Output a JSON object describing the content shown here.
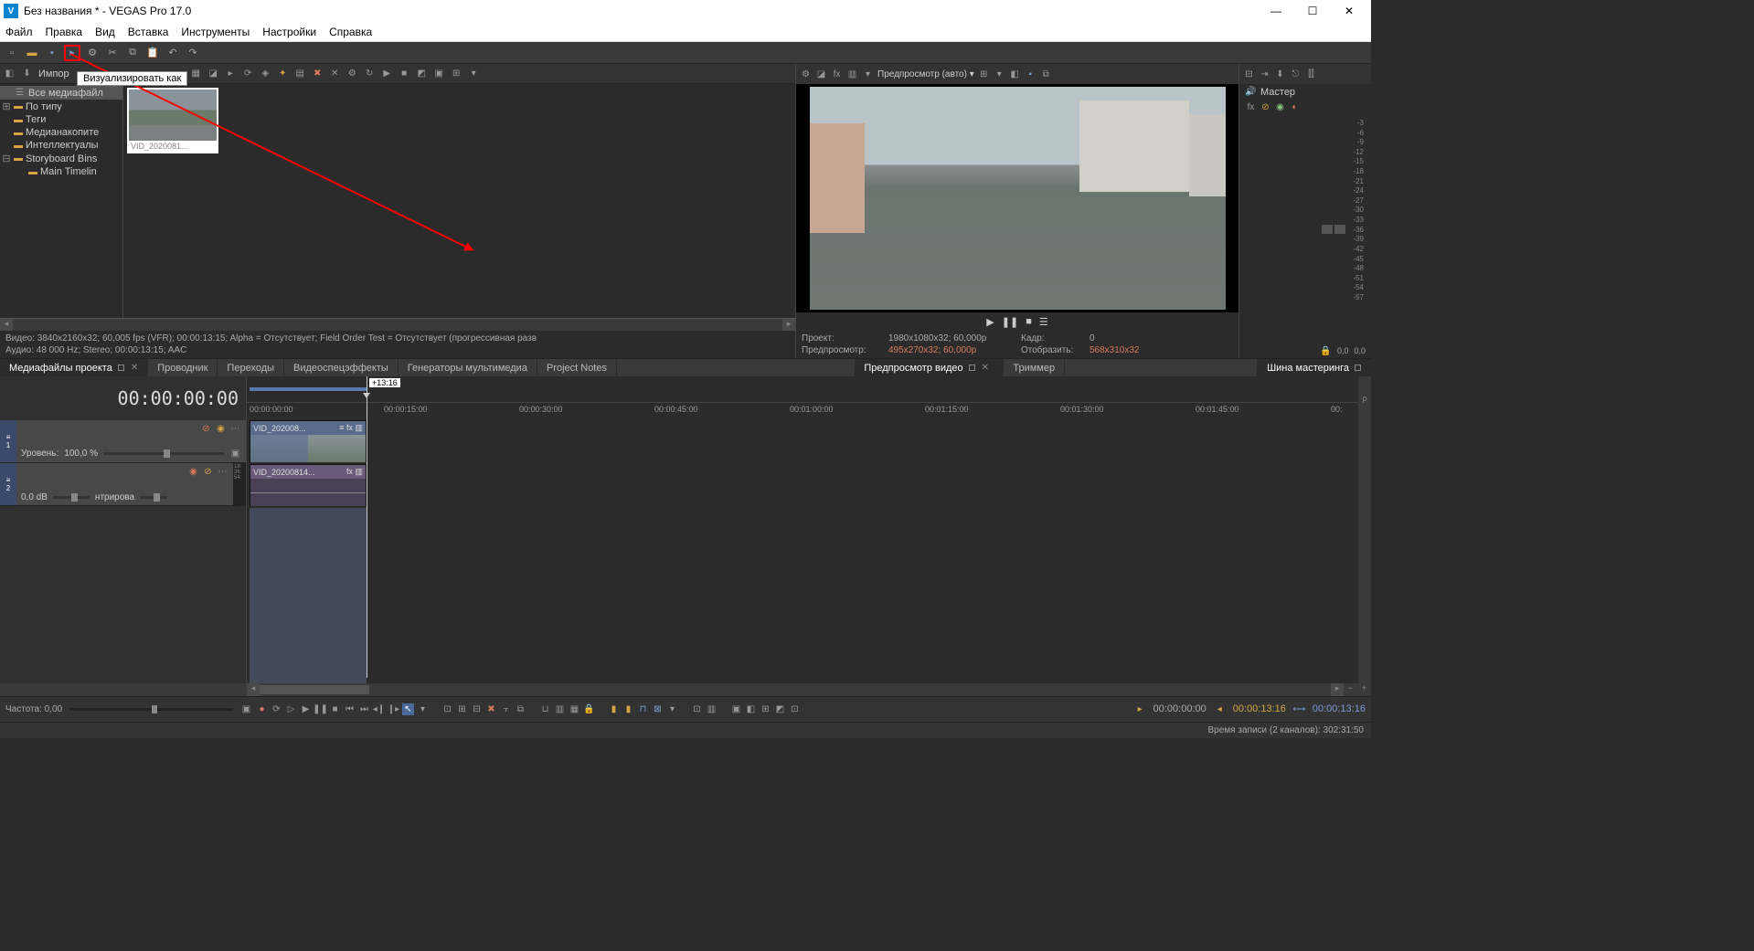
{
  "title": "Без названия * - VEGAS Pro 17.0",
  "menu": {
    "file": "Файл",
    "edit": "Правка",
    "view": "Вид",
    "insert": "Вставка",
    "tools": "Инструменты",
    "settings": "Настройки",
    "help": "Справка"
  },
  "tooltip": "Визуализировать как",
  "import_label": "Импор",
  "tree": {
    "all_media": "Все медиафайл",
    "by_type": "По типу",
    "tags": "Теги",
    "media_storage": "Медианакопите",
    "intellectual": "Интеллектуалы",
    "storyboard": "Storyboard Bins",
    "main_timeline": "Main Timelin"
  },
  "thumb_name": "VID_2020081...",
  "media_info": {
    "video": "Видео: 3840x2160x32; 60,005 fps (VFR); 00:00:13:15; Alpha = Отсутствует; Field Order Test = Отсутствует (прогрессивная разв",
    "audio": "Аудио: 48 000 Hz; Stereo; 00:00:13:15; AAC"
  },
  "tabs_left": {
    "media": "Медиафайлы проекта",
    "explorer": "Проводник",
    "transitions": "Переходы",
    "videofx": "Видеоспецэффекты",
    "generators": "Генераторы мультимедиа",
    "notes": "Project Notes"
  },
  "preview": {
    "mode": "Предпросмотр (авто) ▾",
    "info": {
      "project_l": "Проект:",
      "project_v": "1980x1080x32; 60,000p",
      "frame_l": "Кадр:",
      "frame_v": "0",
      "preview_l": "Предпросмотр:",
      "preview_v": "495x270x32; 60,000p",
      "display_l": "Отобразить:",
      "display_v": "568x310x32"
    }
  },
  "tabs_right": {
    "preview": "Предпросмотр видео",
    "trimmer": "Триммер"
  },
  "master": {
    "label": "Мастер",
    "scale": [
      "-3",
      "-6",
      "-9",
      "-12",
      "-15",
      "-18",
      "-21",
      "-24",
      "-27",
      "-30",
      "-33",
      "-36",
      "-39",
      "-42",
      "-45",
      "-48",
      "-51",
      "-54",
      "-57"
    ],
    "bottom_l": "0,0",
    "bottom_r": "0,0"
  },
  "master_tab": "Шина мастеринга",
  "timeline": {
    "timecode": "00:00:00:00",
    "plus_time": "+13:16",
    "marks": [
      "00:00:00:00",
      "00:00:15:00",
      "00:00:30:00",
      "00:00:45:00",
      "00:01:00:00",
      "00:01:15:00",
      "00:01:30:00",
      "00:01:45:00",
      "00:"
    ],
    "track1": {
      "num": "1",
      "level_l": "Уровень:",
      "level_v": "100,0 %"
    },
    "track2": {
      "num": "2",
      "db": "0,0 dB",
      "pan": "нтрирова",
      "meter": [
        "18:",
        "36:",
        "54:"
      ]
    },
    "clip_video": "VID_202008...",
    "clip_audio": "VID_20200814...",
    "rate": "Частота: 0,00",
    "times": {
      "t1": "00:00:00:00",
      "t2": "00:00:13:16",
      "t3": "00:00:13:16"
    }
  },
  "statusbar": "Время записи (2 каналов): 302:31:50"
}
